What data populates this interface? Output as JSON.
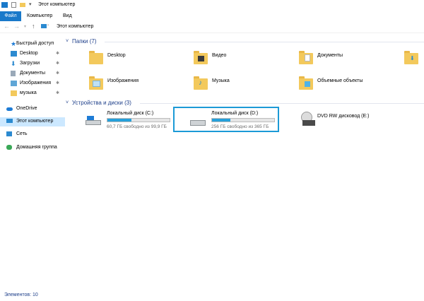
{
  "window": {
    "title": "Этот компьютер"
  },
  "ribbon": {
    "tabs": [
      "Файл",
      "Компьютер",
      "Вид"
    ]
  },
  "address": {
    "path": "Этот компьютер"
  },
  "sidebar": {
    "items": [
      {
        "label": "Быстрый доступ",
        "icon": "star-icon"
      },
      {
        "label": "Desktop",
        "icon": "desktop-icon",
        "pinned": true
      },
      {
        "label": "Загрузки",
        "icon": "download-icon",
        "pinned": true
      },
      {
        "label": "Документы",
        "icon": "documents-icon",
        "pinned": true
      },
      {
        "label": "Изображения",
        "icon": "pictures-icon",
        "pinned": true
      },
      {
        "label": "музыка",
        "icon": "folder-icon",
        "pinned": true
      },
      {
        "label": "OneDrive",
        "icon": "cloud-icon"
      },
      {
        "label": "Этот компьютер",
        "icon": "computer-icon",
        "selected": true
      },
      {
        "label": "Сеть",
        "icon": "network-icon"
      },
      {
        "label": "Домашняя группа",
        "icon": "homegroup-icon"
      }
    ]
  },
  "folders": {
    "header": "Папки (7)",
    "items": [
      "Desktop",
      "Видео",
      "Документы",
      "Изображения",
      "Музыка",
      "Объемные объекты"
    ]
  },
  "devices": {
    "header": "Устройства и диски (3)",
    "items": [
      {
        "name": "Локальный диск (C:)",
        "free": "60,7 ГБ свободно из 99,9 ГБ",
        "used_fraction": 0.39
      },
      {
        "name": "Локальный диск (D:)",
        "free": "256 ГБ свободно из 365 ГБ",
        "used_fraction": 0.3
      },
      {
        "name": "DVD RW дисковод (E:)"
      }
    ]
  },
  "status": {
    "items_count": "Элементов: 10"
  },
  "colors": {
    "accent": "#1979ca",
    "selection": "#cce8ff",
    "bar_fill": "#26a0da",
    "highlight": "#1c9ad6"
  }
}
